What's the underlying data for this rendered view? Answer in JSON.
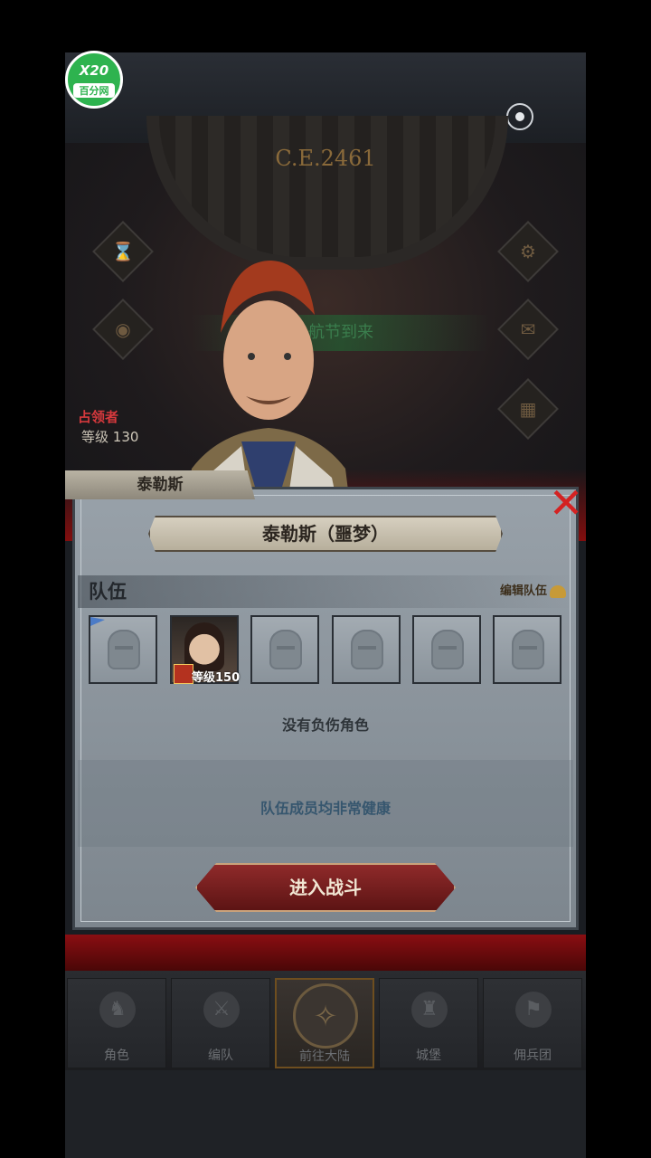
{
  "watermark": {
    "line1": "X20",
    "line2": "百分网"
  },
  "map": {
    "year": "C.E.2461",
    "event_banner": "航节到来"
  },
  "occupier": {
    "label": "占领者",
    "level_label": "等级",
    "level_value": "130"
  },
  "name_tab": "泰勒斯",
  "panel": {
    "title": "泰勒斯（噩梦）",
    "team_label": "队伍",
    "edit_team": "编辑队伍",
    "hero": {
      "level_label": "等级",
      "level_value": "150"
    },
    "no_injured": "没有负伤角色",
    "health_status": "队伍成员均非常健康",
    "battle_button": "进入战斗"
  },
  "nav": [
    {
      "label": "角色",
      "icon": "knight-icon"
    },
    {
      "label": "编队",
      "icon": "squad-icon"
    },
    {
      "label": "前往大陆",
      "icon": "compass-icon"
    },
    {
      "label": "城堡",
      "icon": "castle-icon"
    },
    {
      "label": "佣兵团",
      "icon": "mercenary-icon"
    }
  ],
  "colors": {
    "accent_red": "#d42222",
    "button_red": "#8f2a2a",
    "panel": "#98a1a9"
  }
}
